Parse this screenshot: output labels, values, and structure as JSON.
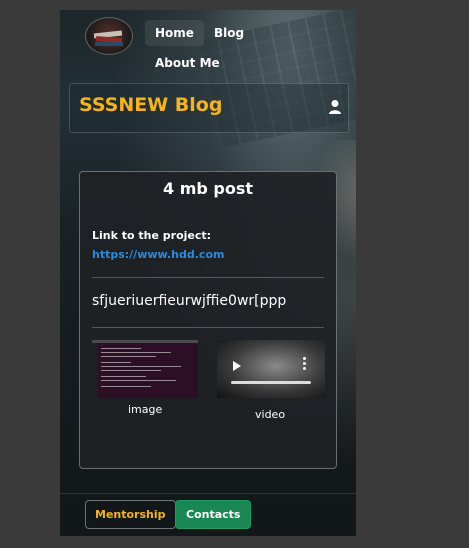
{
  "nav": {
    "home_label": "Home",
    "blog_label": "Blog",
    "about_label": "About Me"
  },
  "site": {
    "title": "SSSNEW Blog",
    "title_color": "#f4b41a"
  },
  "post": {
    "title": "4 mb post",
    "link_label": "Link to the project:",
    "link_url": "https://www.hdd.com",
    "body": "sfjueriuerfieurwjffie0wr[ppp",
    "image_caption": "image",
    "video_caption": "video"
  },
  "footer": {
    "mentorship_label": "Mentorship",
    "contacts_label": "Contacts",
    "contacts_color": "#198754"
  },
  "icons": [
    "user-icon",
    "play-icon",
    "more-vertical-icon"
  ]
}
